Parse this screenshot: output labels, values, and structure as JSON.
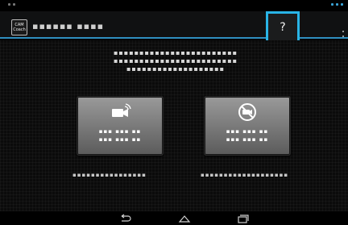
{
  "app": {
    "logo_lines": [
      "CAM",
      "Coach"
    ],
    "title": "▪▪▪▪▪▪ ▪▪▪▪"
  },
  "action_bar": {
    "help_label": "?"
  },
  "main": {
    "instruction": "▪▪▪▪▪▪▪▪▪▪▪▪▪▪▪▪▪▪▪▪▪▪▪▪\n▪▪▪▪▪▪▪▪▪▪▪▪▪▪▪▪▪▪▪▪▪▪▪▪\n▪▪▪▪▪▪▪▪▪▪▪▪▪▪▪▪▪▪▪"
  },
  "modes": {
    "camera": {
      "icon": "video-camera-icon",
      "label": "▪▪▪ ▪▪▪ ▪▪\n▪▪▪ ▪▪▪ ▪▪",
      "caption": "▪▪▪▪▪▪▪▪▪▪▪▪▪▪▪▪"
    },
    "no_camera": {
      "icon": "no-camera-icon",
      "label": "▪▪▪ ▪▪▪ ▪▪\n▪▪▪ ▪▪▪ ▪▪",
      "caption": "▪▪▪▪▪▪▪▪▪▪▪▪▪▪▪▪▪▪▪"
    }
  },
  "nav": {
    "back_icon": "back-icon",
    "home_icon": "home-icon",
    "recent_icon": "recent-apps-icon"
  },
  "colors": {
    "accent": "#29b4e6",
    "action_bar_rule": "#2f8fbf",
    "button_top": "#9a9a9a",
    "button_bottom": "#5b5b5b"
  }
}
